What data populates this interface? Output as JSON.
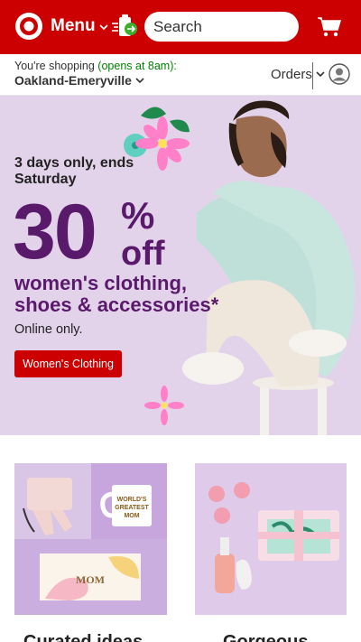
{
  "header": {
    "menu_label": "Menu",
    "search_placeholder": "Search",
    "brand_color": "#cc0000",
    "icons": [
      "target-logo-icon",
      "chevron-down-icon",
      "drive-up-icon",
      "search-icon",
      "cart-icon"
    ]
  },
  "store": {
    "shopping_prefix": "You're shopping",
    "open_text": "(opens at 8am):",
    "store_name": "Oakland-Emeryville",
    "orders_label": "Orders",
    "open_color": "#008300"
  },
  "hero": {
    "tagline": "3 days only, ends Saturday",
    "discount_number": "30",
    "discount_pct": "%",
    "discount_off": "off",
    "headline": "women's clothing, shoes & accessories*",
    "note": "Online only.",
    "cta_label": "Women's Clothing",
    "accent_color": "#5a1a6b",
    "background_color": "#e3d3ea"
  },
  "cards": [
    {
      "title": "Curated ideas",
      "mug_text": "WORLD'S GREATEST MOM",
      "book_text": "MOM"
    },
    {
      "title": "Gorgeous"
    }
  ]
}
